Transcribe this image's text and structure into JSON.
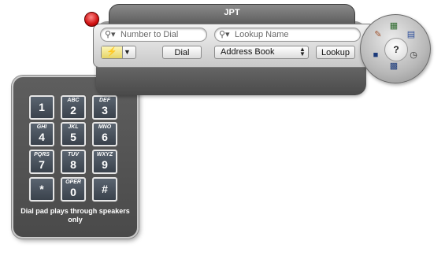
{
  "window": {
    "title": "JPT"
  },
  "toolbar": {
    "number_search": {
      "placeholder": "Number to Dial",
      "icon": "search-icon"
    },
    "name_search": {
      "placeholder": "Lookup Name",
      "icon": "search-icon"
    },
    "dial_label": "Dial",
    "lookup_label": "Lookup",
    "address_source": {
      "selected": "Address Book"
    },
    "dial_type_icon": "phone-signal-icon"
  },
  "wheel": {
    "center_label": "?",
    "icons": [
      "notes-icon",
      "contacts-grid-icon",
      "address-book-icon",
      "clock-icon",
      "calculator-icon",
      "phone-book-icon"
    ]
  },
  "keypad": {
    "keys": [
      {
        "sub": "",
        "num": "1"
      },
      {
        "sub": "ABC",
        "num": "2"
      },
      {
        "sub": "DEF",
        "num": "3"
      },
      {
        "sub": "GHI",
        "num": "4"
      },
      {
        "sub": "JKL",
        "num": "5"
      },
      {
        "sub": "MNO",
        "num": "6"
      },
      {
        "sub": "PQRS",
        "num": "7"
      },
      {
        "sub": "TUV",
        "num": "8"
      },
      {
        "sub": "WXYZ",
        "num": "9"
      },
      {
        "sub": "",
        "num": "*"
      },
      {
        "sub": "OPER",
        "num": "0"
      },
      {
        "sub": "",
        "num": "#"
      }
    ],
    "note": "Dial pad plays through speakers only"
  },
  "colors": {
    "close": "#d01010",
    "panel": "#555555",
    "key": "#3a424c"
  }
}
